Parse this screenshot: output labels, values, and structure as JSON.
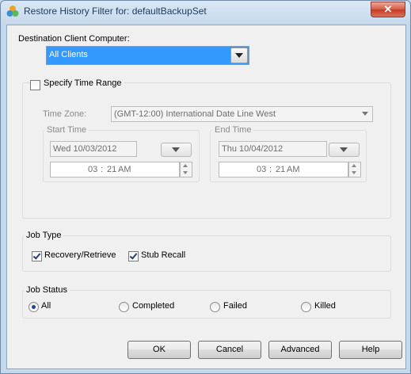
{
  "window": {
    "title": "Restore History Filter for: defaultBackupSet",
    "app_icon": "app-logo-icon",
    "close_glyph": "✕"
  },
  "destination": {
    "label": "Destination Client Computer:",
    "selected": "All Clients"
  },
  "time_range": {
    "checkbox_label": "Specify Time Range",
    "checked": false,
    "timezone_label": "Time Zone:",
    "timezone_value": "(GMT-12:00) International Date Line West",
    "start": {
      "label": "Start Time",
      "date": "Wed 10/03/2012",
      "hour": "03",
      "sep": ":",
      "minute": "21",
      "ampm": "AM"
    },
    "end": {
      "label": "End Time",
      "date": "Thu 10/04/2012",
      "hour": "03",
      "sep": ":",
      "minute": "21",
      "ampm": "AM"
    }
  },
  "job_type": {
    "label": "Job Type",
    "options": [
      {
        "label": "Recovery/Retrieve",
        "checked": true
      },
      {
        "label": "Stub Recall",
        "checked": true
      }
    ]
  },
  "job_status": {
    "label": "Job Status",
    "options": [
      {
        "label": "All",
        "selected": true
      },
      {
        "label": "Completed",
        "selected": false
      },
      {
        "label": "Failed",
        "selected": false
      },
      {
        "label": "Killed",
        "selected": false
      }
    ]
  },
  "buttons": {
    "ok": "OK",
    "cancel": "Cancel",
    "advanced": "Advanced",
    "help": "Help"
  },
  "colors": {
    "selection": "#3399ff",
    "dialog_bg": "#f0f0f0",
    "frame": "#c6d9ec"
  }
}
